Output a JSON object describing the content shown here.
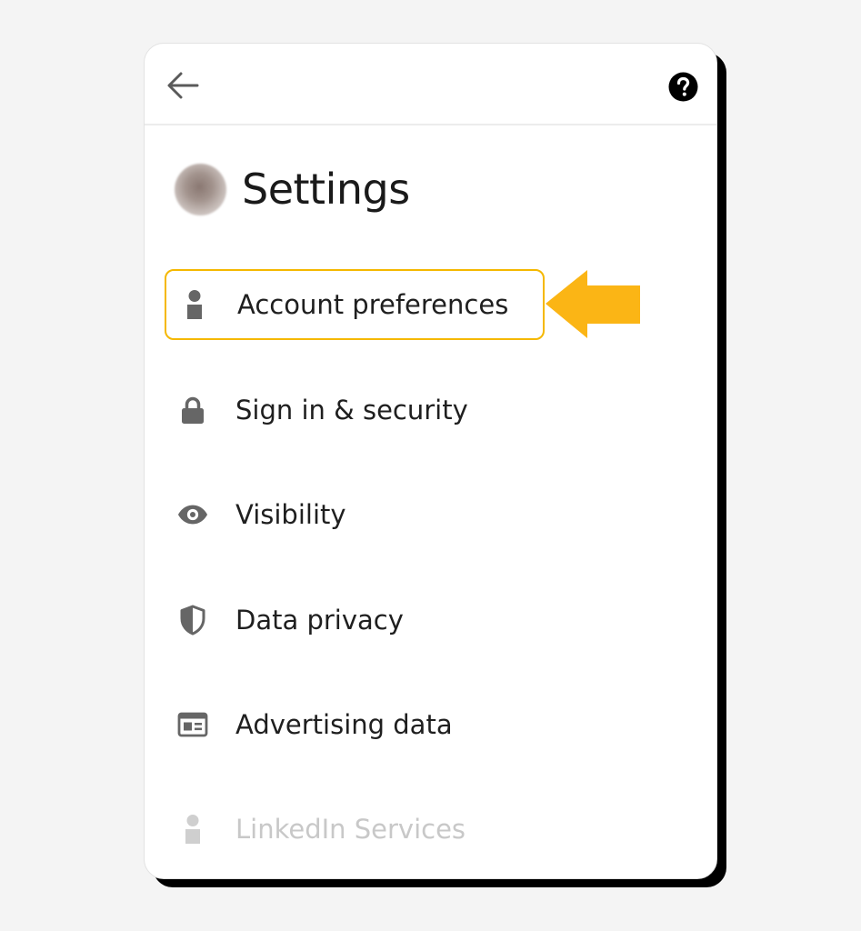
{
  "header": {
    "back_icon": "arrow-left-icon",
    "help_icon": "help-circle-icon"
  },
  "page": {
    "title": "Settings"
  },
  "menu": {
    "items": [
      {
        "label": "Account preferences",
        "icon": "person-icon",
        "highlighted": true
      },
      {
        "label": "Sign in & security",
        "icon": "lock-icon"
      },
      {
        "label": "Visibility",
        "icon": "eye-icon"
      },
      {
        "label": "Data privacy",
        "icon": "shield-icon"
      },
      {
        "label": "Advertising data",
        "icon": "ad-card-icon"
      },
      {
        "label": "LinkedIn Services",
        "icon": "person-icon",
        "faded": true
      }
    ]
  },
  "colors": {
    "highlight": "#f5b800",
    "arrow": "#fbb515",
    "icon": "#666666",
    "text": "#1f1f1f",
    "faded_text": "#c8c8c8"
  }
}
